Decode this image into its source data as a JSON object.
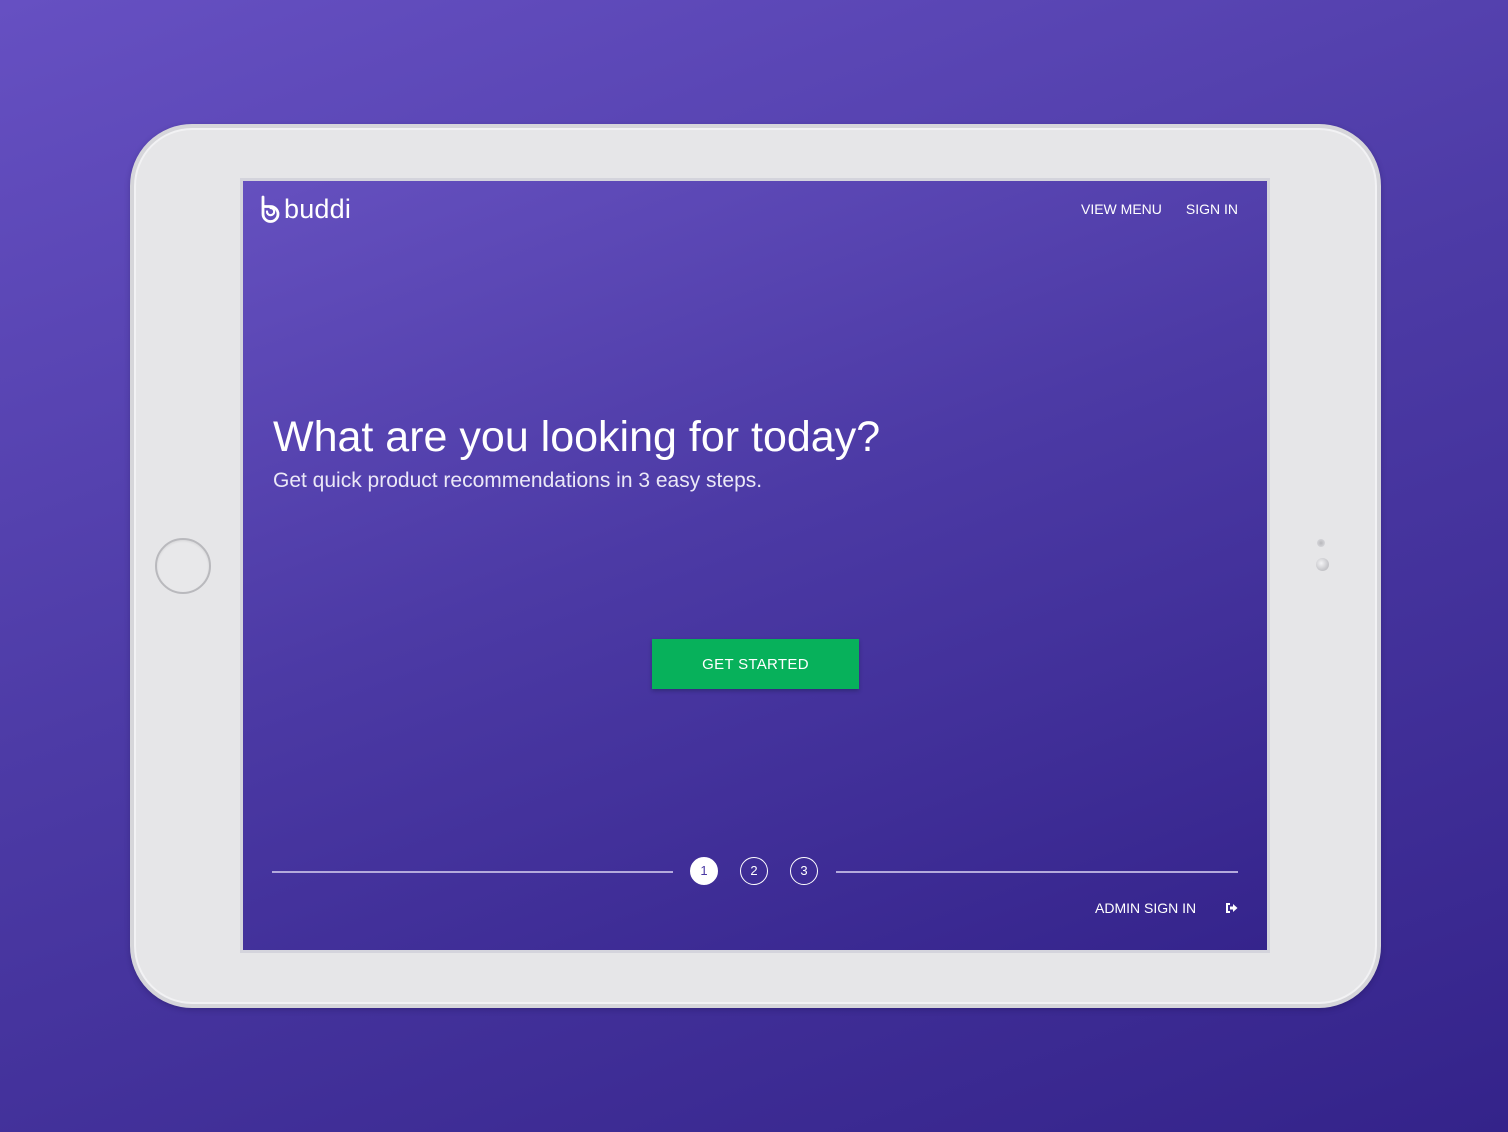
{
  "app": {
    "logo_text": "buddi",
    "brand_color": "#5a46b8",
    "accent_color": "#07b15b"
  },
  "nav": {
    "items": [
      {
        "label": "VIEW MENU"
      },
      {
        "label": "SIGN IN"
      }
    ]
  },
  "hero": {
    "title": "What are you looking for today?",
    "subtitle": "Get quick product recommendations in 3 easy steps."
  },
  "cta": {
    "label": "GET STARTED"
  },
  "steps": {
    "items": [
      "1",
      "2",
      "3"
    ],
    "active": 1
  },
  "footer": {
    "admin_label": "ADMIN SIGN IN",
    "admin_icon": "sign-in-icon"
  },
  "device": {
    "frame_color": "#e6e6e8",
    "home_button_icon": "home-button"
  }
}
